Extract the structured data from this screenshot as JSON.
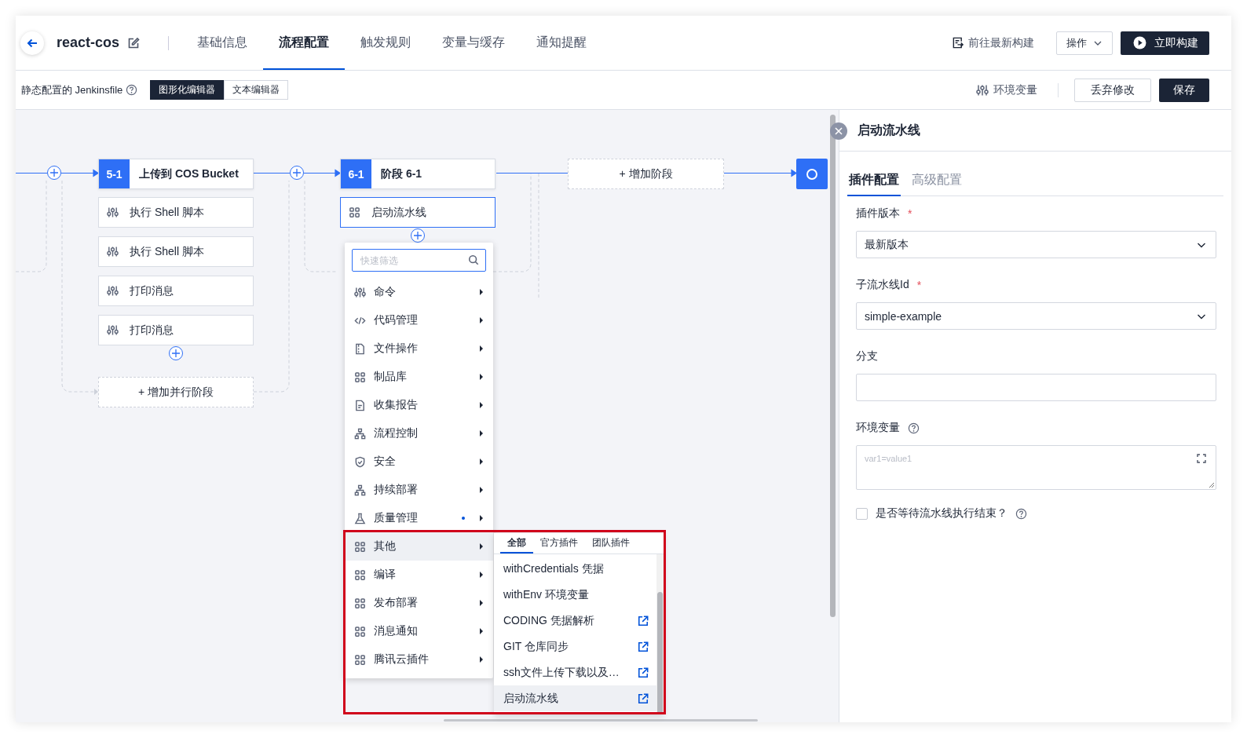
{
  "header": {
    "title": "react-cos",
    "tabs": [
      {
        "label": "基础信息",
        "selected": false
      },
      {
        "label": "流程配置",
        "selected": true
      },
      {
        "label": "触发规则",
        "selected": false
      },
      {
        "label": "变量与缓存",
        "selected": false
      },
      {
        "label": "通知提醒",
        "selected": false
      }
    ],
    "latest_build": "前往最新构建",
    "actions_button": "操作",
    "build_button": "立即构建"
  },
  "toolbar": {
    "label": "静态配置的 Jenkinsfile",
    "editor_modes": [
      {
        "label": "图形化编辑器",
        "selected": true
      },
      {
        "label": "文本编辑器",
        "selected": false
      }
    ],
    "env_vars": "环境变量",
    "discard_button": "丢弃修改",
    "save_button": "保存"
  },
  "pipeline": {
    "stages": [
      {
        "number": "5-1",
        "name": "上传到 COS Bucket",
        "steps": [
          {
            "name": "执行 Shell 脚本",
            "kind": "command",
            "selected": false
          },
          {
            "name": "执行 Shell 脚本",
            "kind": "command",
            "selected": false
          },
          {
            "name": "打印消息",
            "kind": "command",
            "selected": false
          },
          {
            "name": "打印消息",
            "kind": "command",
            "selected": false
          }
        ],
        "add_parallel": "+ 增加并行阶段"
      },
      {
        "number": "6-1",
        "name": "阶段 6-1",
        "steps": [
          {
            "name": "启动流水线",
            "kind": "plugin",
            "selected": true
          }
        ]
      }
    ],
    "add_stage": "+ 增加阶段"
  },
  "plugin_menu": {
    "search": {
      "placeholder": "快速筛选"
    },
    "categories": [
      {
        "label": "命令",
        "kind": "command",
        "selected": false,
        "dot": false
      },
      {
        "label": "代码管理",
        "kind": "code",
        "selected": false,
        "dot": false
      },
      {
        "label": "文件操作",
        "kind": "file",
        "selected": false,
        "dot": false
      },
      {
        "label": "制品库",
        "kind": "grid",
        "selected": false,
        "dot": false
      },
      {
        "label": "收集报告",
        "kind": "report",
        "selected": false,
        "dot": false
      },
      {
        "label": "流程控制",
        "kind": "flow",
        "selected": false,
        "dot": false
      },
      {
        "label": "安全",
        "kind": "security",
        "selected": false,
        "dot": false
      },
      {
        "label": "持续部署",
        "kind": "flow",
        "selected": false,
        "dot": false
      },
      {
        "label": "质量管理",
        "kind": "flask",
        "selected": false,
        "dot": true
      },
      {
        "label": "其他",
        "kind": "grid",
        "selected": true,
        "dot": false
      },
      {
        "label": "编译",
        "kind": "grid",
        "selected": false,
        "dot": false
      },
      {
        "label": "发布部署",
        "kind": "grid",
        "selected": false,
        "dot": false
      },
      {
        "label": "消息通知",
        "kind": "grid",
        "selected": false,
        "dot": false
      },
      {
        "label": "腾讯云插件",
        "kind": "grid",
        "selected": false,
        "dot": false
      }
    ],
    "submenu": {
      "highlighted": true,
      "tabs": [
        {
          "label": "全部",
          "selected": true
        },
        {
          "label": "官方插件",
          "selected": false
        },
        {
          "label": "团队插件",
          "selected": false
        }
      ],
      "items": [
        {
          "label": "withCredentials 凭据",
          "external": false,
          "selected": false
        },
        {
          "label": "withEnv 环境变量",
          "external": false,
          "selected": false
        },
        {
          "label": "CODING 凭据解析",
          "external": true,
          "selected": false
        },
        {
          "label": "GIT 仓库同步",
          "external": true,
          "selected": false
        },
        {
          "label": "ssh文件上传下载以及…",
          "external": true,
          "selected": false
        },
        {
          "label": "启动流水线",
          "external": true,
          "selected": true
        }
      ]
    }
  },
  "side_panel": {
    "title": "启动流水线",
    "tabs": [
      {
        "label": "插件配置",
        "selected": true
      },
      {
        "label": "高级配置",
        "selected": false
      }
    ],
    "fields": [
      {
        "kind": "select",
        "label": "插件版本",
        "required_mark": "*",
        "value": "最新版本"
      },
      {
        "kind": "select",
        "label": "子流水线Id",
        "required_mark": "*",
        "value": "simple-example"
      },
      {
        "kind": "text",
        "label": "分支"
      },
      {
        "kind": "textarea",
        "label": "环境变量",
        "help": true,
        "placeholder": "var1=value1"
      }
    ],
    "checkbox": {
      "label": "是否等待流水线执行结束？",
      "checked": false,
      "help": true
    }
  }
}
